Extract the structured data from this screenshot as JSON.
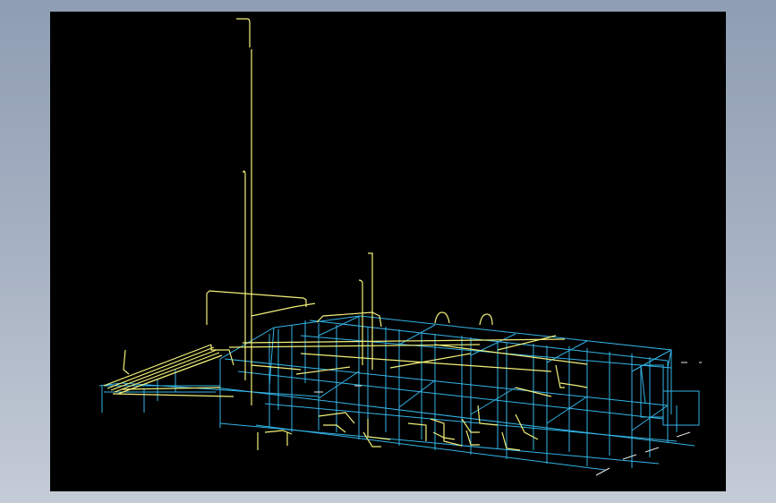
{
  "screen": {
    "background_color": "#98a5b9",
    "viewport_background": "#000000"
  },
  "model": {
    "view": "3d-wireframe",
    "colors": {
      "steel_structure": "#33b5e8",
      "piping": "#f3f07a",
      "dimension_marks": "#e8e8e8"
    }
  }
}
